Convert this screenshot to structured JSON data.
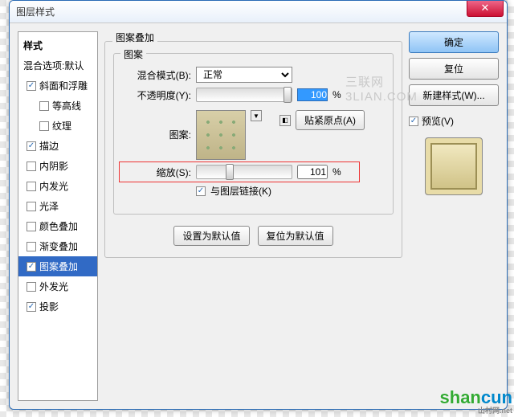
{
  "title": "图层样式",
  "watermark": "三联网 3LIAN.COM",
  "sidebar": {
    "header": "样式",
    "sub": "混合选项:默认",
    "items": [
      {
        "label": "斜面和浮雕",
        "checked": true,
        "indent": false
      },
      {
        "label": "等高线",
        "checked": false,
        "indent": true
      },
      {
        "label": "纹理",
        "checked": false,
        "indent": true
      },
      {
        "label": "描边",
        "checked": true,
        "indent": false
      },
      {
        "label": "内阴影",
        "checked": false,
        "indent": false
      },
      {
        "label": "内发光",
        "checked": false,
        "indent": false
      },
      {
        "label": "光泽",
        "checked": false,
        "indent": false
      },
      {
        "label": "颜色叠加",
        "checked": false,
        "indent": false
      },
      {
        "label": "渐变叠加",
        "checked": false,
        "indent": false
      },
      {
        "label": "图案叠加",
        "checked": true,
        "indent": false,
        "active": true
      },
      {
        "label": "外发光",
        "checked": false,
        "indent": false
      },
      {
        "label": "投影",
        "checked": true,
        "indent": false
      }
    ]
  },
  "panel": {
    "title": "图案叠加",
    "section": "图案",
    "blend_label": "混合模式(B):",
    "blend_value": "正常",
    "opacity_label": "不透明度(Y):",
    "opacity_value": "100",
    "percent": "%",
    "pattern_label": "图案:",
    "snap_label": "贴紧原点(A)",
    "scale_label": "缩放(S):",
    "scale_value": "101",
    "link_label": "与图层链接(K)",
    "defaults_btn": "设置为默认值",
    "reset_btn": "复位为默认值"
  },
  "right": {
    "ok": "确定",
    "cancel": "复位",
    "newstyle": "新建样式(W)...",
    "preview_label": "预览(V)"
  },
  "wm2": {
    "a": "shan",
    "b": "cun",
    "c": "山村网.net"
  }
}
